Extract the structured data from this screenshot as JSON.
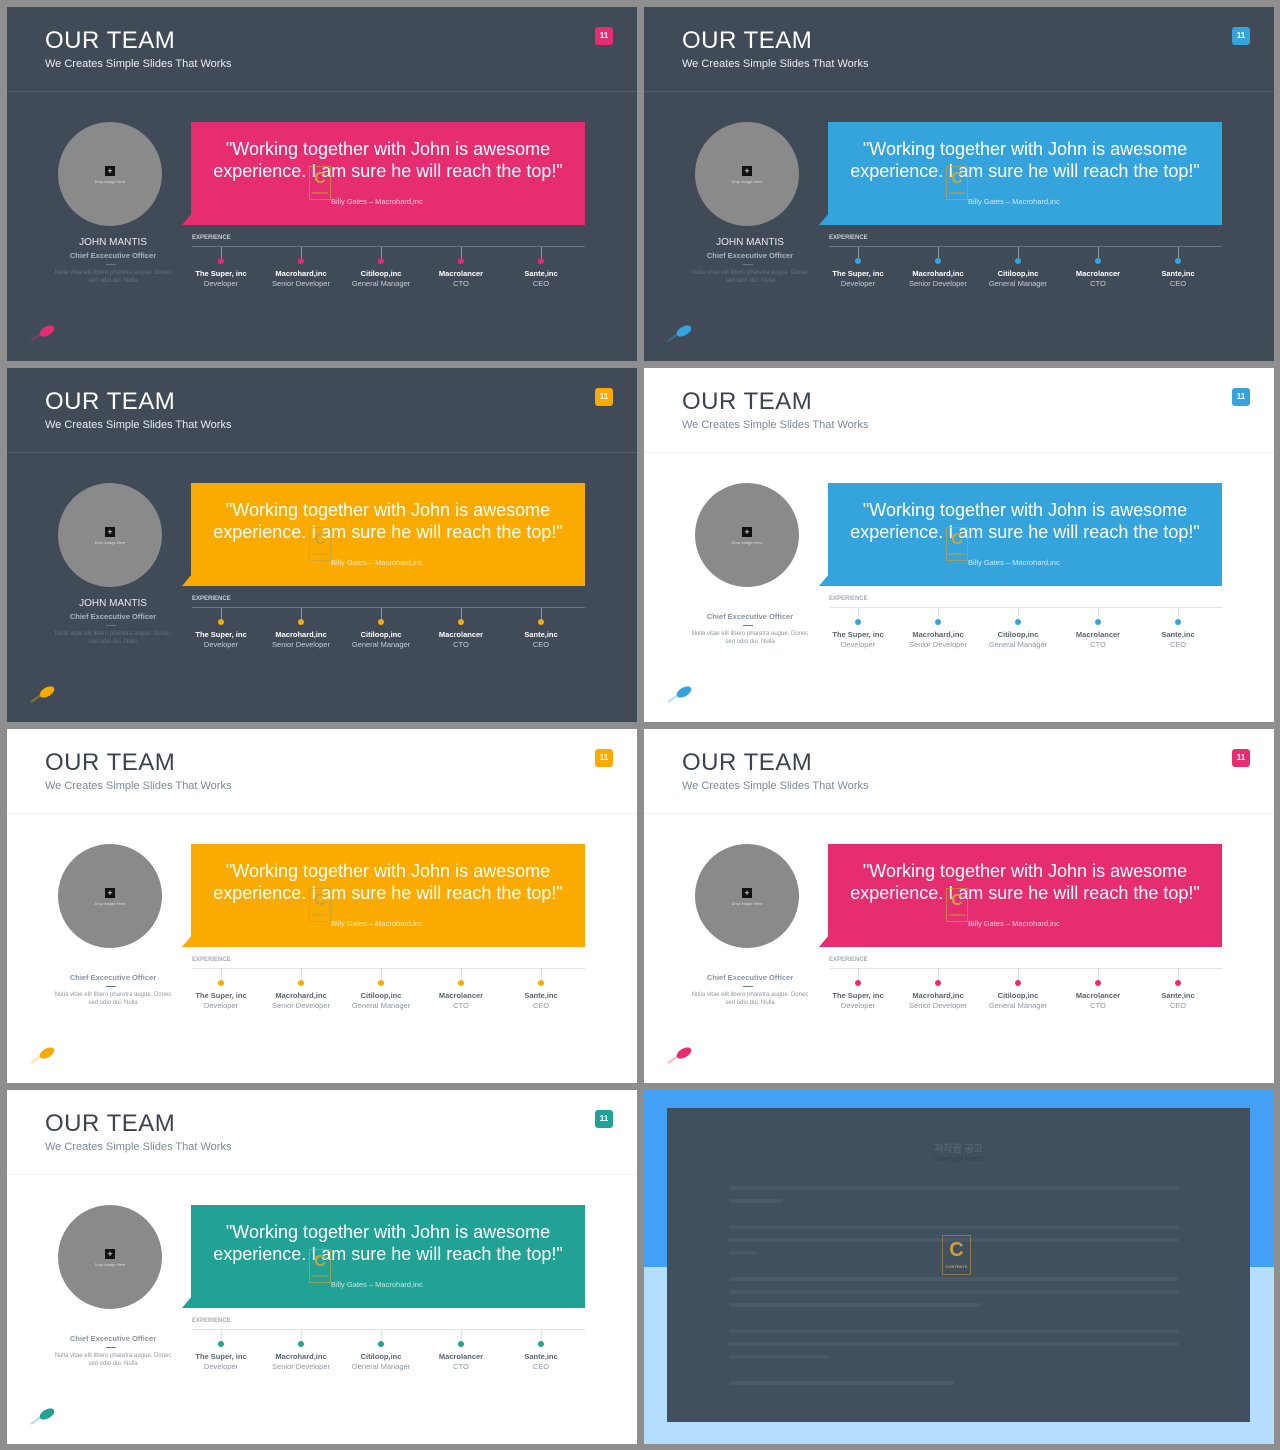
{
  "slides": [
    {
      "theme": "dark",
      "accent": "#e52d6f",
      "show_name": true
    },
    {
      "theme": "dark",
      "accent": "#35a4dd",
      "show_name": true
    },
    {
      "theme": "dark",
      "accent": "#fbab00",
      "show_name": true
    },
    {
      "theme": "light",
      "accent": "#35a4dd",
      "show_name": false
    },
    {
      "theme": "light",
      "accent": "#fbab00",
      "show_name": false
    },
    {
      "theme": "light",
      "accent": "#e52d6f",
      "show_name": false
    },
    {
      "theme": "light",
      "accent": "#22a295",
      "show_name": false
    }
  ],
  "content": {
    "title": "OUR TEAM",
    "subtitle": "We Creates Simple Slides That Works",
    "page_number": "11",
    "drop_image": "Drop Image Here",
    "plus_icon": "+",
    "person_name": "JOHN MANTIS",
    "person_role": "Chief Excecutive Officer",
    "bio": "Nulla vitae elit libero pharetra augue. Donec sed odio dui. Nulla",
    "quote": "\"Working together with John is awesome experience. I am sure he will reach the top!\"",
    "quote_author": "Billy Gates – Macrohard,inc",
    "experience_label": "EXPERIENCE",
    "experience": [
      {
        "company": "The Super, inc",
        "position": "Developer"
      },
      {
        "company": "Macrohard,inc",
        "position": "Senior Developer"
      },
      {
        "company": "Citiloop,inc",
        "position": "General Manager"
      },
      {
        "company": "Macrolancer",
        "position": "CTO"
      },
      {
        "company": "Sante,inc",
        "position": "CEO"
      }
    ],
    "watermark_logo": "C"
  },
  "notice": {
    "title": "저작권 공고",
    "subtitle": "Copyright Notice",
    "logo": "C"
  }
}
